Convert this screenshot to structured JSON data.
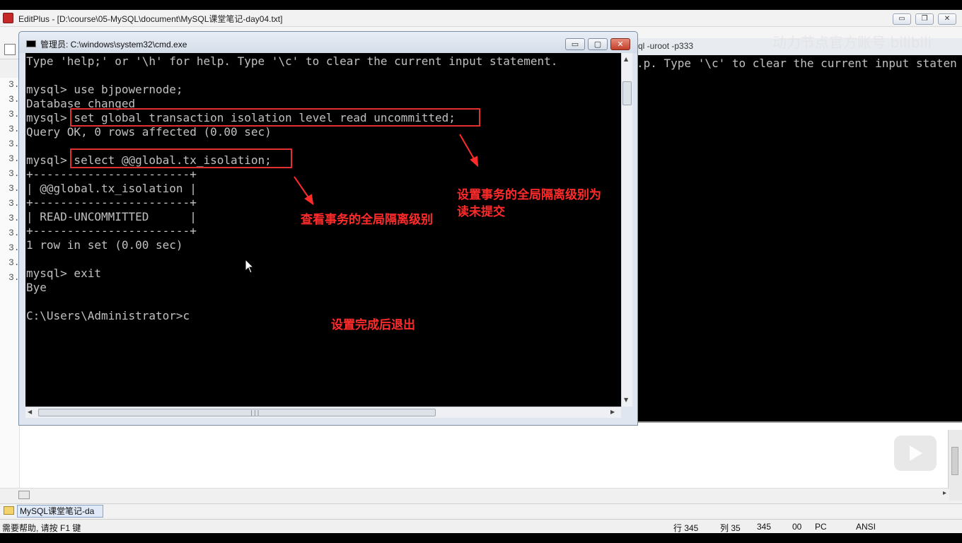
{
  "editplus": {
    "title": "EditPlus - [D:\\course\\05-MySQL\\document\\MySQL课堂笔记-day04.txt]",
    "minimize": "▭",
    "restore": "❐",
    "close": "✕",
    "line_numbers": [
      "3.",
      "3.",
      "3.",
      "3.",
      "3.",
      "3.",
      "3.",
      "3.",
      "3.",
      "3.",
      "3.",
      "3.",
      "3.",
      "3."
    ],
    "doc_tab": "MySQL课堂笔记-da",
    "status": {
      "help": "需要帮助, 请按 F1 键",
      "line": "行 345",
      "col": "列 35",
      "pos": "345",
      "num": "00",
      "mode": "PC",
      "encoding": "ANSI"
    }
  },
  "cmd2": {
    "title_fragment": "ql  -uroot -p333",
    "line": ".p. Type '\\c' to clear the current input staten"
  },
  "cmd": {
    "title": "管理员: C:\\windows\\system32\\cmd.exe",
    "minimize": "▭",
    "maximize": "▢",
    "close": "✕",
    "lines": [
      "Type 'help;' or '\\h' for help. Type '\\c' to clear the current input statement.",
      "",
      "mysql> use bjpowernode;",
      "Database changed",
      "mysql> set global transaction isolation level read uncommitted;",
      "Query OK, 0 rows affected (0.00 sec)",
      "",
      "mysql> select @@global.tx_isolation;",
      "+-----------------------+",
      "| @@global.tx_isolation |",
      "+-----------------------+",
      "| READ-UNCOMMITTED      |",
      "+-----------------------+",
      "1 row in set (0.00 sec)",
      "",
      "mysql> exit",
      "Bye",
      "",
      "C:\\Users\\Administrator>c"
    ],
    "hscroll_grip": "|||"
  },
  "annotations": {
    "set_isolation_line1": "设置事务的全局隔离级别为",
    "set_isolation_line2": "读未提交",
    "view_isolation": "查看事务的全局隔离级别",
    "exit_after": "设置完成后退出",
    "color": "#ff2b2b"
  },
  "watermark": "动力节点官方账号 bilibili"
}
